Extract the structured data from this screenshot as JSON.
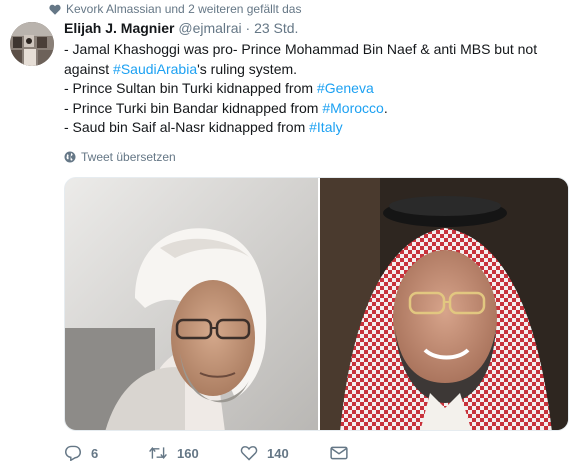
{
  "social_context": "Kevork Almassian und 2 weiteren gefällt das",
  "author": {
    "name": "Elijah J. Magnier",
    "handle": "@ejmalrai",
    "separator": "·",
    "time": "23 Std."
  },
  "tweet": {
    "line1a": "- Jamal Khashoggi was pro- Prince Mohammad Bin Naef & anti MBS but not",
    "line1b_pre": "against ",
    "line1b_link": "#SaudiArabia",
    "line1b_post": "'s ruling system.",
    "line2_pre": "- Prince Sultan bin Turki kidnapped from ",
    "line2_link": "#Geneva",
    "line3_pre": "- Prince Turki bin Bandar kidnapped from ",
    "line3_link": "#Morocco",
    "line3_post": ".",
    "line4_pre": "- Saud bin Saif al-Nasr kidnapped from ",
    "line4_link": "#Italy"
  },
  "translate_label": "Tweet übersetzen",
  "actions": {
    "replies": "6",
    "retweets": "160",
    "likes": "140"
  },
  "colors": {
    "link": "#1da1f2",
    "secondary_text": "#657786",
    "primary_text": "#14171a"
  },
  "icons": [
    "heart-icon",
    "globe-icon",
    "reply-icon",
    "retweet-icon",
    "like-icon"
  ]
}
